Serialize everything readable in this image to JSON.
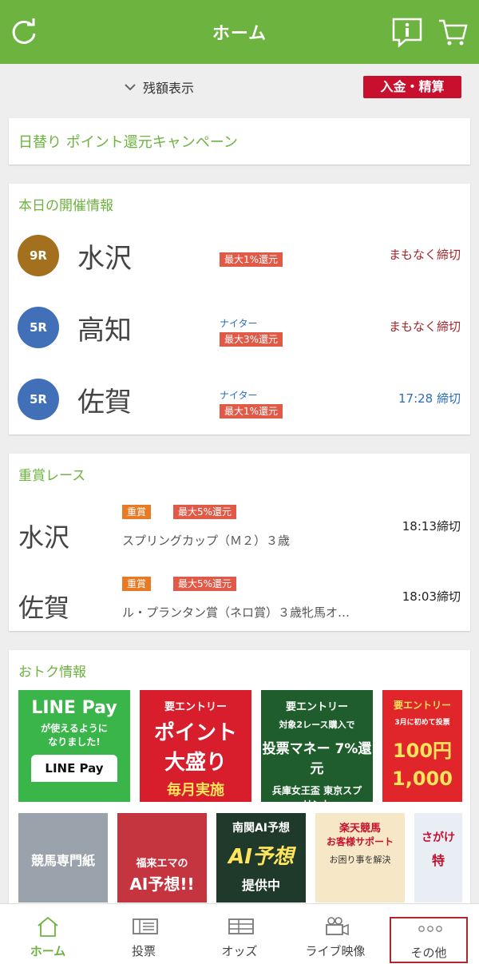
{
  "header": {
    "title": "ホーム"
  },
  "balance": {
    "toggle_label": "残額表示",
    "deposit_label": "入金・精算"
  },
  "campaign": {
    "label": "日替り ポイント還元キャンペーン"
  },
  "today": {
    "title": "本日の開催情報",
    "races": [
      {
        "race": "9R",
        "venue": "水沢",
        "night": "",
        "rebate": "最大1%還元",
        "status": "まもなく締切",
        "badge_color": "#a3701e",
        "status_color": "#a2262b"
      },
      {
        "race": "5R",
        "venue": "高知",
        "night": "ナイター",
        "rebate": "最大3%還元",
        "status": "まもなく締切",
        "badge_color": "#4170b8",
        "status_color": "#a2262b"
      },
      {
        "race": "5R",
        "venue": "佐賀",
        "night": "ナイター",
        "rebate": "最大1%還元",
        "status": "17:28 締切",
        "badge_color": "#4170b8",
        "status_color": "#2a6ebb"
      }
    ]
  },
  "graded": {
    "title": "重賞レース",
    "races": [
      {
        "venue": "水沢",
        "grade_tag": "重賞",
        "rebate": "最大5%還元",
        "name": "スプリングカップ（Ｍ２）３歳",
        "time": "18:13締切"
      },
      {
        "venue": "佐賀",
        "grade_tag": "重賞",
        "rebate": "最大5%還元",
        "name": "ル・プランタン賞（ネロ賞）３歳牝馬オ…",
        "time": "18:03締切"
      }
    ]
  },
  "deals": {
    "title": "おトク情報",
    "banners_row1": [
      {
        "line1": "LINE Pay",
        "line2": "が使えるように",
        "line3": "なりました!",
        "line4": "LINE Pay",
        "bg": "#39b54a"
      },
      {
        "line1": "要エントリー",
        "line2": "ポイント",
        "line3": "大盛り",
        "line4": "毎月実施",
        "bg": "#d81e2c"
      },
      {
        "line1": "要エントリー",
        "line2": "対象2レース購入で",
        "line3": "投票マネー 7%還元",
        "line4": "兵庫女王盃 東京スプリント",
        "bg": "#1f5e2c"
      },
      {
        "line1": "要エントリー",
        "line2": "3月に初めて投票",
        "line3": "100円",
        "line4": "1,000",
        "bg": "#e0262a"
      }
    ],
    "banners_row2": [
      {
        "line1": "競馬専門紙",
        "bg": "#9aa3ab"
      },
      {
        "line1": "福来エマの",
        "line2": "AI予想!!",
        "bg": "#c4353f"
      },
      {
        "line1": "南関AI予想",
        "line2": "AI予想",
        "line3": "提供中",
        "bg": "#1f3a2a"
      },
      {
        "line1": "楽天競馬",
        "line2": "お客様サポート",
        "line3": "お困り事を解決",
        "bg": "#f6e8c6"
      },
      {
        "line1": "さがけ",
        "line2": "特",
        "bg": "#e8eef4"
      }
    ]
  },
  "tabbar": {
    "tabs": [
      {
        "label": "ホーム"
      },
      {
        "label": "投票"
      },
      {
        "label": "オッズ"
      },
      {
        "label": "ライブ映像"
      },
      {
        "label": "その他"
      }
    ]
  },
  "colors": {
    "brand_green": "#6db33f",
    "deposit_red": "#c8102e",
    "tag_red": "#e05a47",
    "tag_orange": "#e87a23"
  }
}
